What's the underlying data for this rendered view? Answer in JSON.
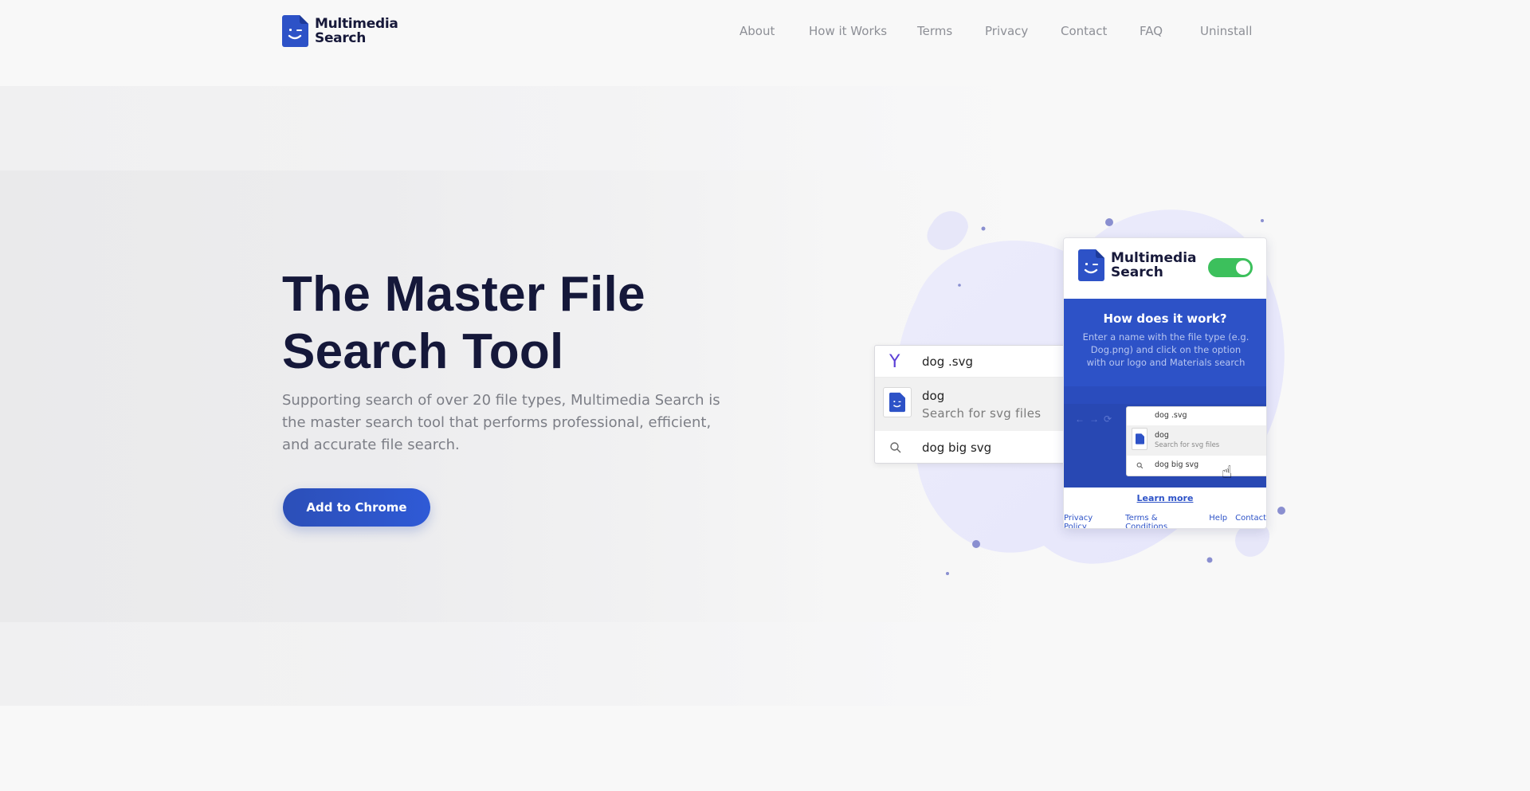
{
  "brand": {
    "name_line1": "Multimedia",
    "name_line2": "Search",
    "logo_icon": "smiling-file-icon",
    "accent_color": "#2d52c7",
    "title_color": "#15183a"
  },
  "nav": {
    "items": [
      "About",
      "How it Works",
      "Terms",
      "Privacy",
      "Contact",
      "FAQ",
      "Uninstall"
    ]
  },
  "hero": {
    "title": "The Master File Search Tool",
    "subtitle": "Supporting search of over 20 file types, Multimedia Search is the master search tool that performs professional, efficient, and accurate file search.",
    "cta_label": "Add to Chrome"
  },
  "search_demo": {
    "query": "dog .svg",
    "suggestion_title": "dog",
    "suggestion_subtitle": "Search for svg files",
    "search_suggestion": "dog big svg",
    "engine_icon": "yahoo-y-icon"
  },
  "popup": {
    "name_line1": "Multimedia",
    "name_line2": "Search",
    "toggle_on": true,
    "toggle_color": "#3cc05c",
    "heading": "How does it work?",
    "description": "Enter a name with the file type (e.g. Dog.png) and click on the option with our logo and Materials search",
    "mini_query": "dog .svg",
    "mini_suggestion_title": "dog",
    "mini_suggestion_subtitle": "Search for svg files",
    "mini_search_suggestion": "dog big svg",
    "learn_more": "Learn more",
    "footer_links": [
      "Privacy Policy",
      "Terms & Conditions",
      "Help",
      "Contact"
    ]
  }
}
